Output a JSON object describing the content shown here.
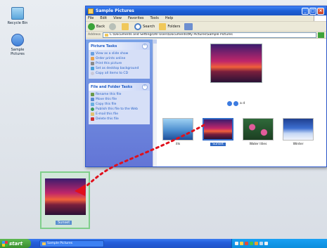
{
  "desktop": {
    "icons": [
      {
        "label": "Recycle Bin",
        "icon": "recycle-bin-icon"
      },
      {
        "label": "Sample Pictures",
        "icon": "folder-icon"
      }
    ]
  },
  "window": {
    "title": "Sample Pictures",
    "menu": [
      "File",
      "Edit",
      "View",
      "Favorites",
      "Tools",
      "Help"
    ],
    "toolbar": {
      "back": "Back",
      "search": "Search",
      "folders": "Folders"
    },
    "address": {
      "label": "Address",
      "value": "C:\\Documents and Settings\\All Users\\Documents\\My Pictures\\Sample Pictures"
    },
    "picture_tasks": {
      "title": "Picture Tasks",
      "items": [
        "View as a slide show",
        "Order prints online",
        "Print this picture",
        "Set as desktop background",
        "Copy all items to CD"
      ]
    },
    "file_tasks": {
      "title": "File and Folder Tasks",
      "items": [
        "Rename this file",
        "Move this file",
        "Copy this file",
        "Publish this file to the Web",
        "E-mail this file",
        "Delete this file"
      ]
    },
    "thumbnails": [
      {
        "label": "ills",
        "selected": false
      },
      {
        "label": "Sunset",
        "selected": true
      },
      {
        "label": "Water lilies",
        "selected": false
      },
      {
        "label": "Winter",
        "selected": false
      }
    ],
    "nav_text": "a d"
  },
  "drag_preview": {
    "label": "Sunset"
  },
  "taskbar": {
    "start": "start",
    "task": "Sample Pictures",
    "clock": ""
  },
  "colors": {
    "titlebar": "#1d5fd6",
    "taskpane": "#6f8fe0",
    "selection": "#316ac5",
    "drag_arrow": "#e0101c"
  }
}
